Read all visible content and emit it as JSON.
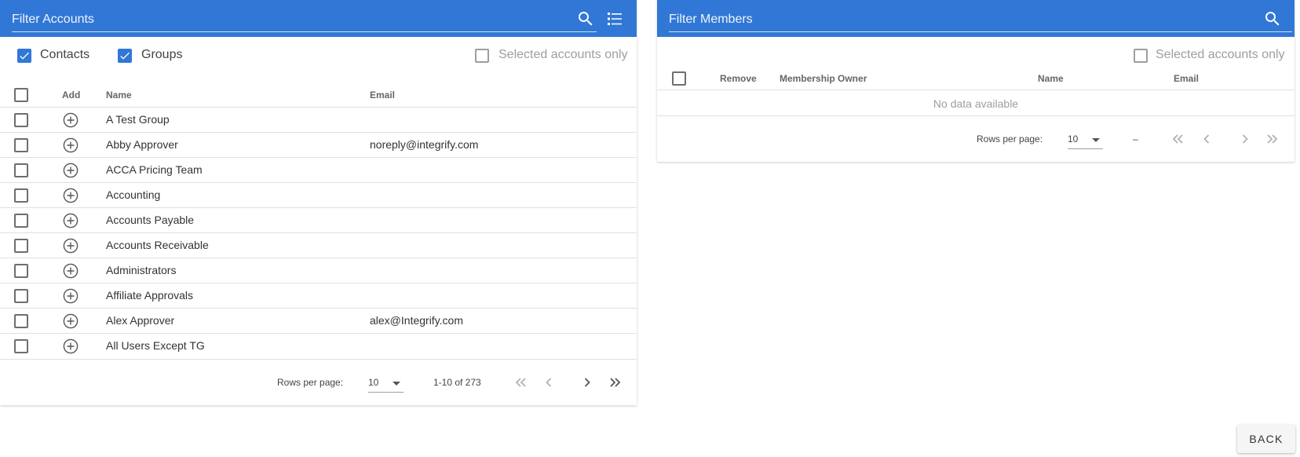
{
  "accounts": {
    "filter_placeholder": "Filter Accounts",
    "icons": {
      "search": "search-icon",
      "list": "list-view-icon"
    },
    "toggles": {
      "contacts": {
        "label": "Contacts",
        "checked": true
      },
      "groups": {
        "label": "Groups",
        "checked": true
      },
      "selected_only": {
        "label": "Selected accounts only",
        "checked": false
      }
    },
    "columns": {
      "add": "Add",
      "name": "Name",
      "email": "Email"
    },
    "rows": [
      {
        "name": "A Test Group",
        "email": ""
      },
      {
        "name": "Abby Approver",
        "email": "noreply@integrify.com"
      },
      {
        "name": "ACCA Pricing Team",
        "email": ""
      },
      {
        "name": "Accounting",
        "email": ""
      },
      {
        "name": "Accounts Payable",
        "email": ""
      },
      {
        "name": "Accounts Receivable",
        "email": ""
      },
      {
        "name": "Administrators",
        "email": ""
      },
      {
        "name": "Affiliate Approvals",
        "email": ""
      },
      {
        "name": "Alex Approver",
        "email": "alex@Integrify.com"
      },
      {
        "name": "All Users Except TG",
        "email": ""
      }
    ],
    "footer": {
      "rows_per_page_label": "Rows per page:",
      "rows_per_page": "10",
      "range": "1-10 of 273"
    }
  },
  "members": {
    "filter_placeholder": "Filter Members",
    "icons": {
      "search": "search-icon"
    },
    "toggles": {
      "selected_only": {
        "label": "Selected accounts only",
        "checked": false
      }
    },
    "columns": {
      "remove": "Remove",
      "owner": "Membership Owner",
      "name": "Name",
      "email": "Email"
    },
    "empty_text": "No data available",
    "footer": {
      "rows_per_page_label": "Rows per page:",
      "rows_per_page": "10",
      "range": "–"
    }
  },
  "back_label": "BACK"
}
